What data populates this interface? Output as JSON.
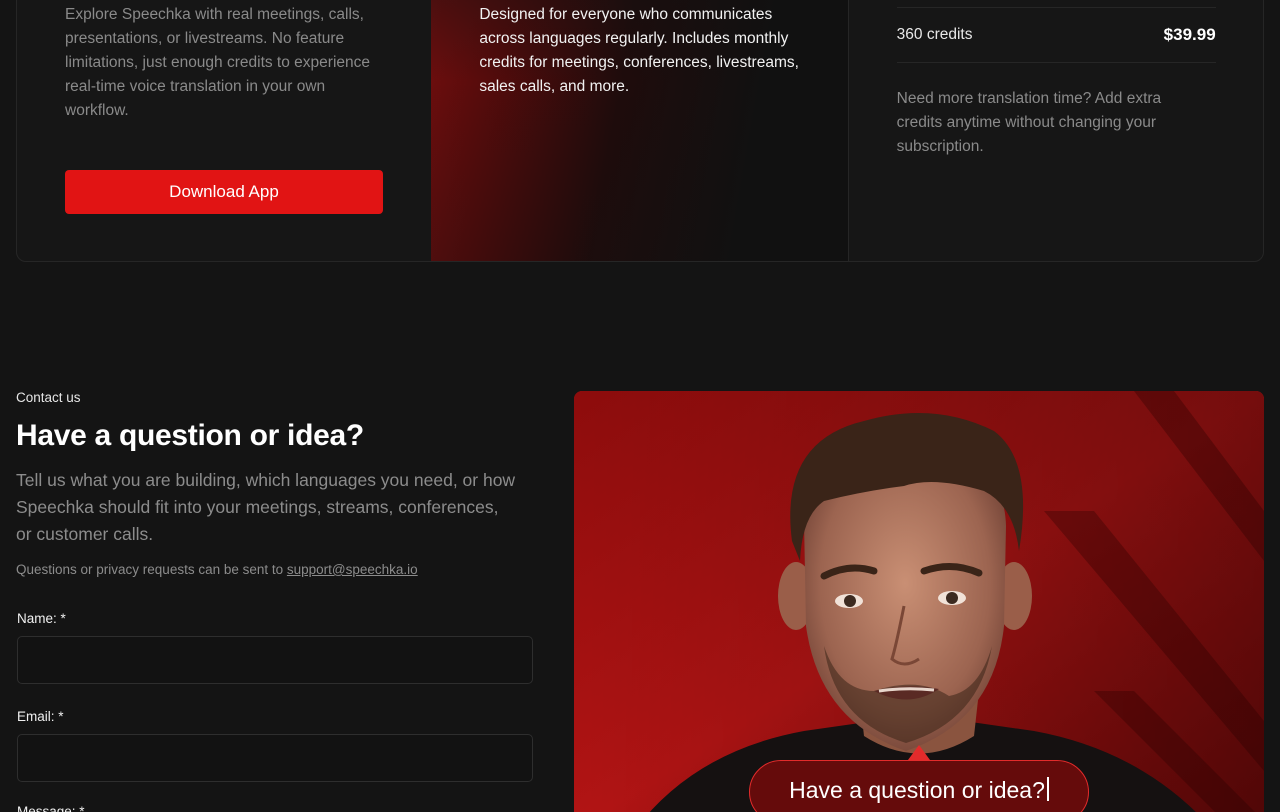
{
  "pricing": {
    "free": {
      "description": "Explore Speechka with real meetings, calls, presentations, or livestreams. No feature limitations, just enough credits to experience real-time voice translation in your own workflow.",
      "cta_label": "Download App"
    },
    "pro": {
      "description": "Designed for everyone who communicates across languages regularly. Includes monthly credits for meetings, conferences, livestreams, sales calls, and more."
    },
    "credits": {
      "package_amount": "360 credits",
      "package_price": "$39.99",
      "note": "Need more translation time? Add extra credits anytime without changing your subscription."
    }
  },
  "contact": {
    "eyebrow": "Contact us",
    "title": "Have a question or idea?",
    "lead": "Tell us what you are building, which languages you need, or how Speechka should fit into your meetings, streams, conferences, or customer calls.",
    "privacy_prefix": "Questions or privacy requests can be sent to ",
    "support_email": "support@speechka.io",
    "fields": {
      "name_label": "Name: *",
      "email_label": "Email: *",
      "message_label": "Message: *"
    }
  },
  "hero": {
    "caption": "Have a question or idea?",
    "accent_color": "#e11414",
    "background_color": "#141414"
  }
}
